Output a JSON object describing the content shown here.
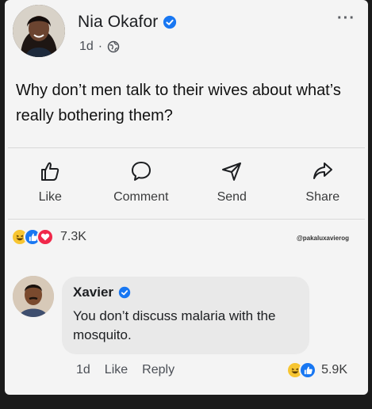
{
  "post": {
    "author": "Nia Okafor",
    "time": "1d",
    "separator": "·",
    "privacy_icon": "globe-icon",
    "text": "Why don’t men talk to their wives about what’s really bothering them?",
    "more_icon": "more-options-icon",
    "more_label": "···"
  },
  "actions": [
    {
      "label": "Like",
      "icon": "thumbs-up-icon"
    },
    {
      "label": "Comment",
      "icon": "comment-icon"
    },
    {
      "label": "Send",
      "icon": "send-icon"
    },
    {
      "label": "Share",
      "icon": "share-icon"
    }
  ],
  "reactions": {
    "count": "7.3K",
    "types": [
      "haha",
      "like",
      "love"
    ]
  },
  "watermark": "@pakaluxavierog",
  "comment": {
    "author": "Xavier",
    "text": "You don’t discuss malaria with the mosquito.",
    "time": "1d",
    "like_label": "Like",
    "reply_label": "Reply",
    "reaction_count": "5.9K"
  },
  "colors": {
    "verified": "#1877f2",
    "like": "#1877f2",
    "haha": "#f7c531",
    "love": "#f0284a"
  }
}
